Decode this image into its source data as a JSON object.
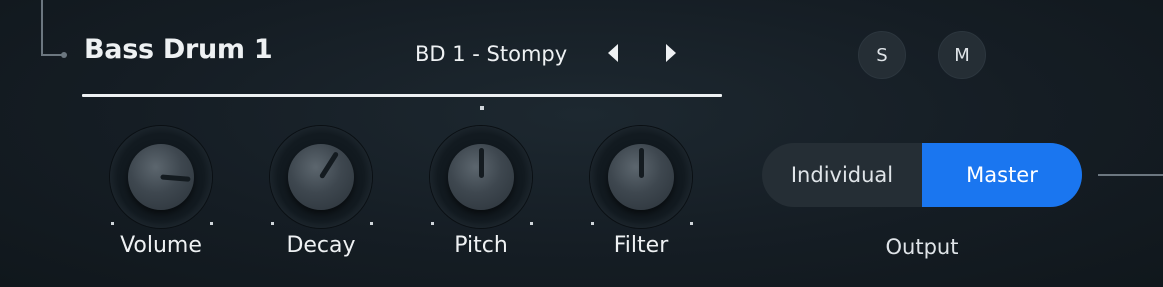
{
  "channel": {
    "name": "Bass Drum 1",
    "preset": "BD 1 - Stompy"
  },
  "buttons": {
    "solo": "S",
    "mute": "M"
  },
  "knobs": [
    {
      "label": "Volume",
      "value": 0.85
    },
    {
      "label": "Decay",
      "value": 0.62
    },
    {
      "label": "Pitch",
      "value": 0.5
    },
    {
      "label": "Filter",
      "value": 0.5
    }
  ],
  "output": {
    "label": "Output",
    "options": [
      "Individual",
      "Master"
    ],
    "selected": "Master"
  },
  "colors": {
    "accent": "#1a76f0",
    "background": "#151d24"
  }
}
